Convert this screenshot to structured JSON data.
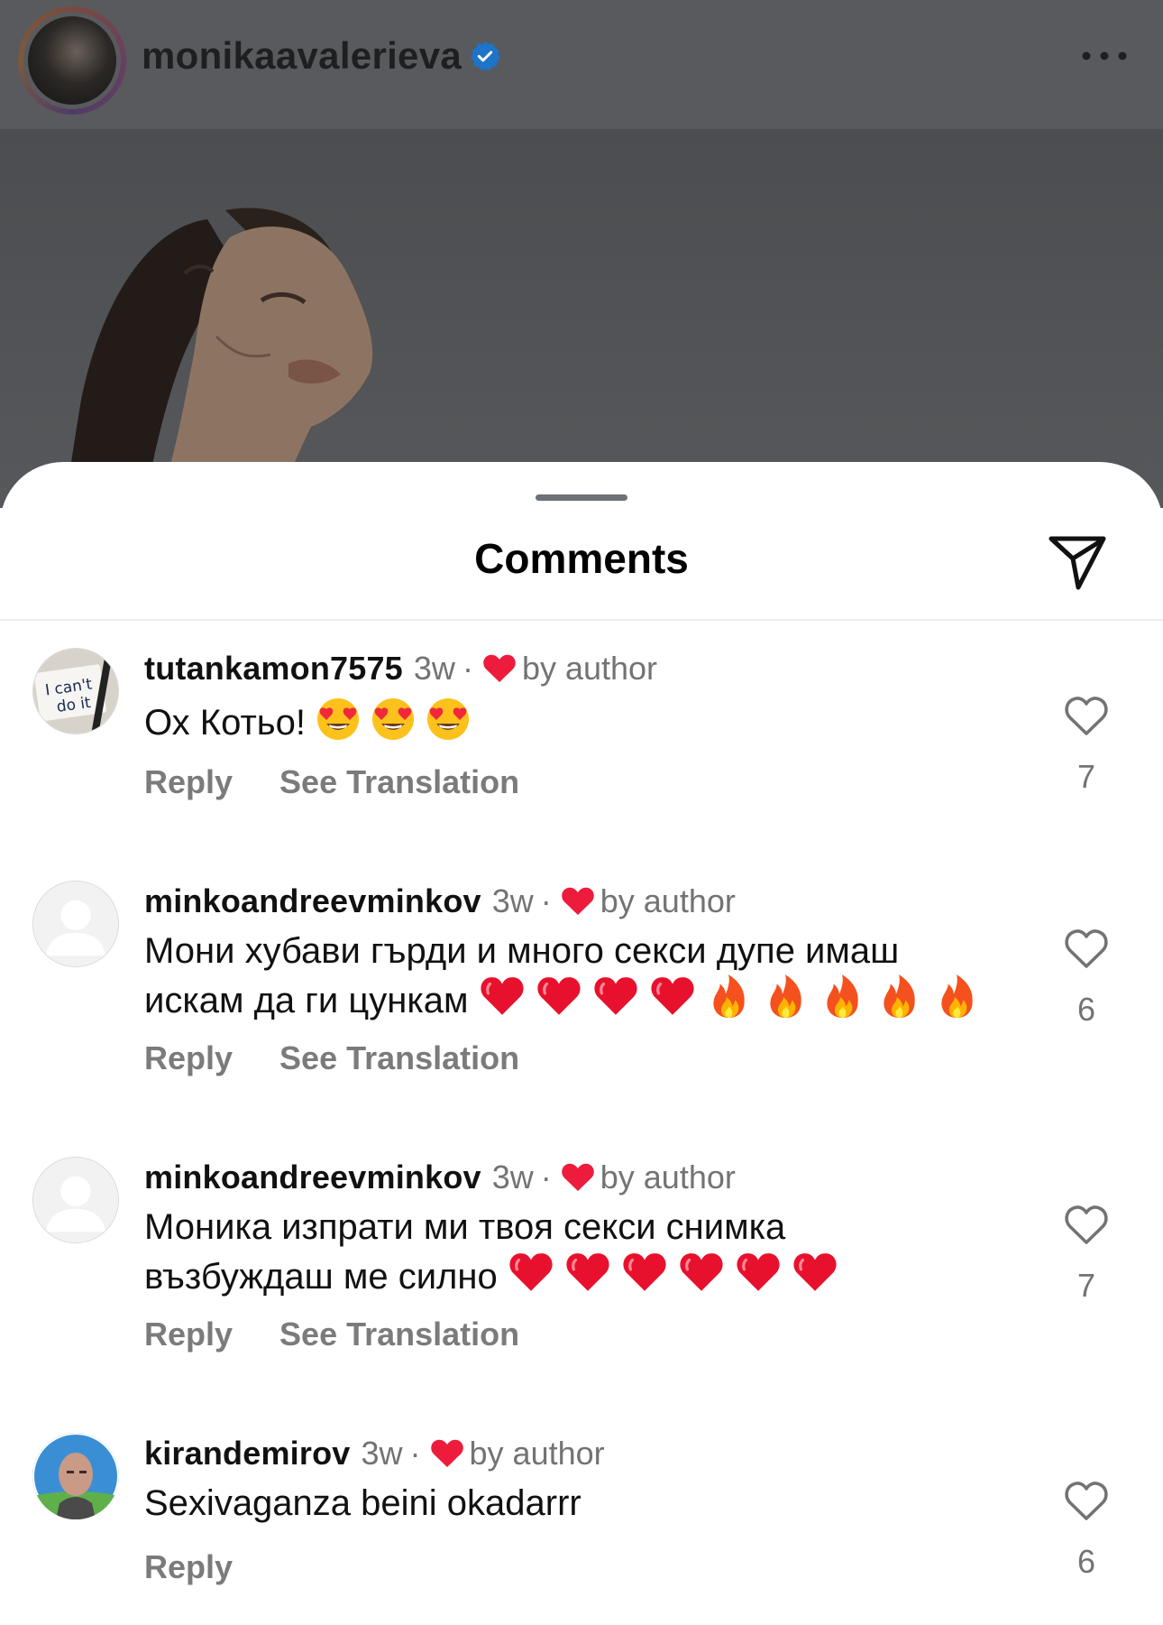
{
  "post": {
    "username": "monikaavalerieva",
    "verified": true,
    "more_icon": "more-horizontal-icon"
  },
  "sheet": {
    "title": "Comments",
    "share_icon": "paper-plane-icon"
  },
  "comments": [
    {
      "username": "tutankamon7575",
      "time": "3w",
      "by_author": "by author",
      "text": "Ох Котьо!",
      "emojis": [
        "heart-eyes",
        "heart-eyes",
        "heart-eyes"
      ],
      "actions": [
        "Reply",
        "See Translation"
      ],
      "likes": "7",
      "avatar": "sign-note-avatar",
      "avatar_text": "I can't do it"
    },
    {
      "username": "minkoandreevminkov",
      "time": "3w",
      "by_author": "by author",
      "text_line1": "Мони хубави гърди и много секси дупе имаш",
      "text_line2": "искам да ги цункам",
      "emojis": [
        "red-heart",
        "red-heart",
        "red-heart",
        "red-heart",
        "fire",
        "fire",
        "fire",
        "fire",
        "fire"
      ],
      "actions": [
        "Reply",
        "See Translation"
      ],
      "likes": "6",
      "avatar": "default-avatar"
    },
    {
      "username": "minkoandreevminkov",
      "time": "3w",
      "by_author": "by author",
      "text_line1": "Моника изпрати ми твоя секси снимка",
      "text_line2": "възбуждаш ме силно",
      "emojis": [
        "red-heart",
        "red-heart",
        "red-heart",
        "red-heart",
        "red-heart",
        "red-heart"
      ],
      "actions": [
        "Reply",
        "See Translation"
      ],
      "likes": "7",
      "avatar": "default-avatar"
    },
    {
      "username": "kirandemirov",
      "time": "3w",
      "by_author": "by author",
      "text": "Sexivaganza beini okadarrr",
      "actions": [
        "Reply"
      ],
      "likes": "6",
      "avatar": "photo-avatar"
    }
  ],
  "colors": {
    "heart_red": "#ed1c3c",
    "muted_text": "#737373",
    "verified_blue": "#1d74c9"
  }
}
